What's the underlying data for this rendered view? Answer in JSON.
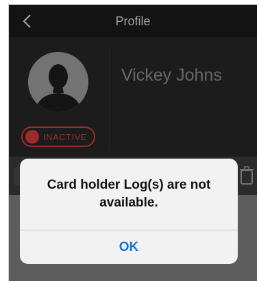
{
  "navbar": {
    "title": "Profile",
    "back_icon": "chevron-left-icon"
  },
  "profile": {
    "name": "Vickey Johns",
    "avatar_icon": "person-silhouette-icon",
    "status": "INACTIVE"
  },
  "colors": {
    "status": "#d33a3a",
    "accent": "#1273d9",
    "background": "#262626"
  },
  "alert": {
    "message": "Card holder Log(s) are not available.",
    "ok_label": "OK"
  }
}
